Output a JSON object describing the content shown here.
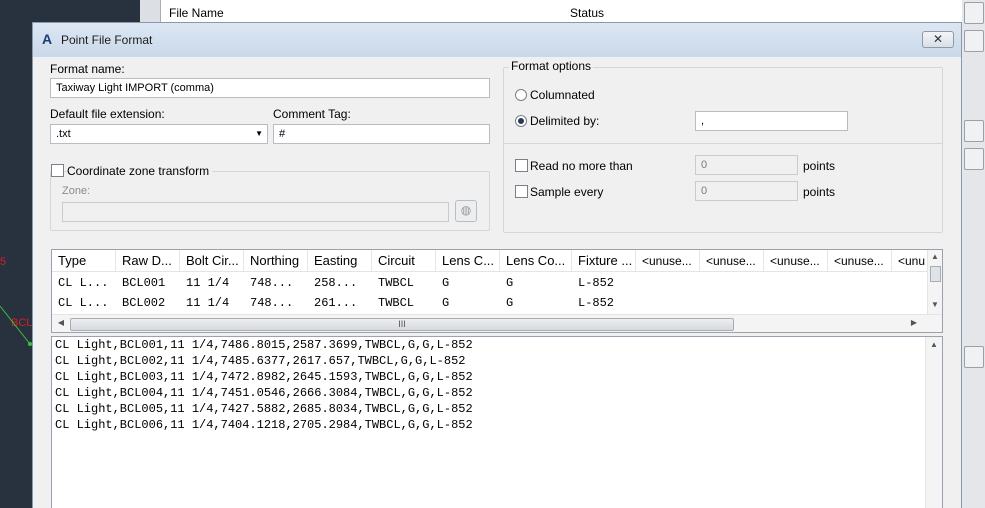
{
  "background": {
    "left_labels": [
      "5",
      "BCL"
    ],
    "file_list_headers": [
      "File Name",
      "Status"
    ]
  },
  "dialog": {
    "title": "Point File Format",
    "close_icon": "close-icon",
    "format_name": {
      "label": "Format name:",
      "value": "Taxiway Light IMPORT (comma)"
    },
    "default_ext": {
      "label": "Default file extension:",
      "value": ".txt"
    },
    "comment_tag": {
      "label": "Comment Tag:",
      "value": "#"
    },
    "coord_zone": {
      "label": "Coordinate zone transform",
      "checked": false,
      "zone_label": "Zone:",
      "zone_value": ""
    },
    "format_options": {
      "label": "Format options",
      "columnated": {
        "label": "Columnated",
        "selected": false
      },
      "delimited": {
        "label": "Delimited by:",
        "selected": true,
        "value": ","
      },
      "read_no_more": {
        "label": "Read no more than",
        "checked": false,
        "value": "0",
        "unit": "points"
      },
      "sample_every": {
        "label": "Sample every",
        "checked": false,
        "value": "0",
        "unit": "points"
      }
    },
    "grid": {
      "headers": [
        "Type",
        "Raw D...",
        "Bolt Cir...",
        "Northing",
        "Easting",
        "Circuit",
        "Lens C...",
        "Lens Co...",
        "Fixture ...",
        "<unuse...",
        "<unuse...",
        "<unuse...",
        "<unuse...",
        "<unu"
      ],
      "rows": [
        [
          "CL L...",
          "BCL001",
          "11 1/4",
          "748...",
          "258...",
          "TWBCL",
          "G",
          "G",
          "L-852"
        ],
        [
          "CL L...",
          "BCL002",
          "11 1/4",
          "748...",
          "261...",
          "TWBCL",
          "G",
          "G",
          "L-852"
        ]
      ],
      "hscroll_grip": "III"
    },
    "preview_lines": [
      "CL Light,BCL001,11 1/4,7486.8015,2587.3699,TWBCL,G,G,L-852",
      "CL Light,BCL002,11 1/4,7485.6377,2617.657,TWBCL,G,G,L-852",
      "CL Light,BCL003,11 1/4,7472.8982,2645.1593,TWBCL,G,G,L-852",
      "CL Light,BCL004,11 1/4,7451.0546,2666.3084,TWBCL,G,G,L-852",
      "CL Light,BCL005,11 1/4,7427.5882,2685.8034,TWBCL,G,G,L-852",
      "CL Light,BCL006,11 1/4,7404.1218,2705.2984,TWBCL,G,G,L-852"
    ]
  }
}
